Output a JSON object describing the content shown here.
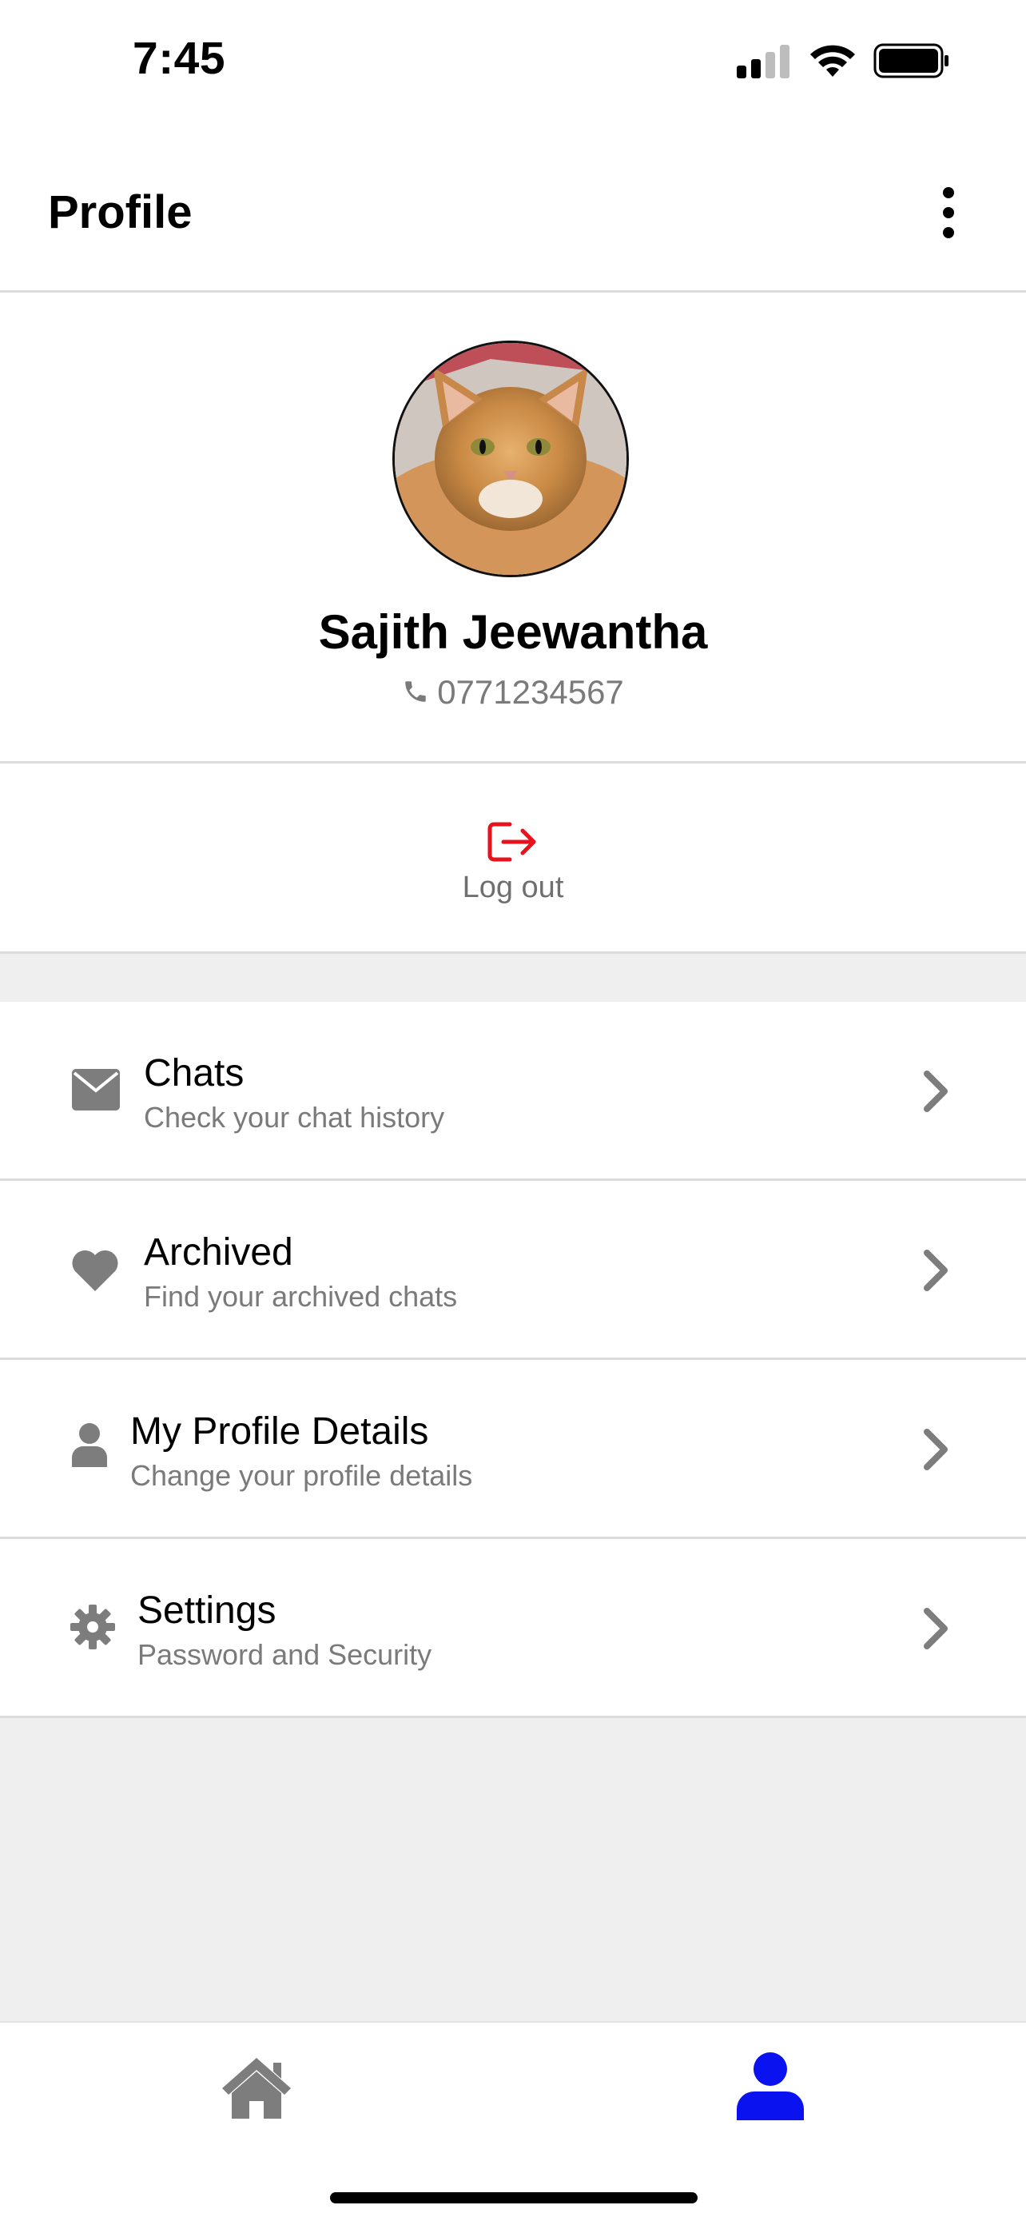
{
  "status_bar": {
    "time": "7:45",
    "icons": [
      "signal-icon",
      "wifi-icon",
      "battery-icon"
    ]
  },
  "header": {
    "title": "Profile",
    "menu_icon": "more-vertical-icon"
  },
  "profile": {
    "avatar_description": "avatar-photo",
    "name": "Sajith Jeewantha",
    "phone": "0771234567",
    "phone_icon": "phone-icon"
  },
  "logout": {
    "label": "Log out",
    "icon": "logout-icon",
    "color": "#e8121c"
  },
  "menu": {
    "items": [
      {
        "title": "Chats",
        "subtitle": "Check your chat history",
        "icon": "envelope-icon"
      },
      {
        "title": "Archived",
        "subtitle": "Find your archived chats",
        "icon": "heart-icon"
      },
      {
        "title": "My Profile Details",
        "subtitle": "Change your profile details",
        "icon": "user-icon"
      },
      {
        "title": "Settings",
        "subtitle": "Password and Security",
        "icon": "gear-icon"
      }
    ]
  },
  "bottom_nav": {
    "items": [
      {
        "name": "home",
        "icon": "home-icon",
        "active": false
      },
      {
        "name": "profile",
        "icon": "user-icon",
        "active": true
      }
    ],
    "active_color": "#0a12f0",
    "inactive_color": "#7d7d7d"
  }
}
